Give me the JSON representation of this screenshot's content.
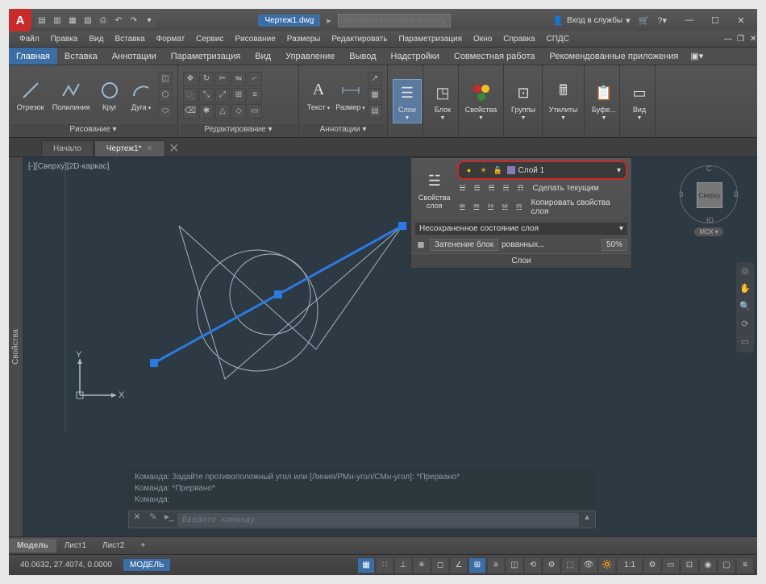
{
  "title": {
    "doc": "Чертеж1.dwg",
    "search_placeholder": "Введите ключевое слово/фразу",
    "signin": "Вход в службы"
  },
  "menu": [
    "Файл",
    "Правка",
    "Вид",
    "Вставка",
    "Формат",
    "Сервис",
    "Рисование",
    "Размеры",
    "Редактировать",
    "Параметризация",
    "Окно",
    "Справка",
    "СПДС"
  ],
  "ribbon_tabs": [
    "Главная",
    "Вставка",
    "Аннотации",
    "Параметризация",
    "Вид",
    "Управление",
    "Вывод",
    "Надстройки",
    "Совместная работа",
    "Рекомендованные приложения"
  ],
  "ribbon": {
    "draw": {
      "title": "Рисование ▾",
      "items": [
        "Отрезок",
        "Полилиния",
        "Круг",
        "Дуга"
      ]
    },
    "modify": {
      "title": "Редактирование ▾"
    },
    "annot": {
      "title": "Аннотации ▾",
      "text": "Текст",
      "dim": "Размер"
    },
    "layers": {
      "title": "Слои",
      "btn": "Слои"
    },
    "block": {
      "title": "Блок",
      "btn": "Блок"
    },
    "props": {
      "title": "Свойства",
      "btn": "Свойства"
    },
    "groups": {
      "title": "Группы",
      "btn": "Группы"
    },
    "utils": {
      "title": "Утилиты",
      "btn": "Утилиты"
    },
    "clip": {
      "title": "Буфе...",
      "btn": "Буфе..."
    },
    "view": {
      "title": "Вид",
      "btn": "Вид"
    }
  },
  "file_tabs": {
    "start": "Начало",
    "doc": "Чертеж1*"
  },
  "viewport_label": "[-][Сверху][2D-каркас]",
  "layers_panel": {
    "props_label": "Свойства\nслоя",
    "current_layer": "Слой 1",
    "make_current": "Сделать текущим",
    "copy_props": "Копировать свойства слоя",
    "state": "Несохраненное состояние слоя",
    "fade_label": "Затенение блок",
    "fade_suffix": "рованных...",
    "fade_pct": "50%",
    "title": "Слои"
  },
  "viewcube": {
    "face": "Сверху",
    "n": "С",
    "s": "Ю",
    "e": "В",
    "w": "З",
    "wcs": "МСК ▾"
  },
  "side_panel": "Свойства",
  "cmd": {
    "hist1": "Команда: Задайте противоположный угол или [Линия/РМн-угол/СМн-угол]: *Прервано*",
    "hist2": "Команда: *Прервано*",
    "hist3": "Команда:",
    "placeholder": "Введите команду"
  },
  "bottom_tabs": [
    "Модель",
    "Лист1",
    "Лист2"
  ],
  "status": {
    "coords": "40.0632, 27.4074, 0.0000",
    "model": "МОДЕЛЬ",
    "scale": "1:1"
  },
  "ucs": {
    "x": "X",
    "y": "Y"
  },
  "colors": {
    "accent": "#3a6ea5",
    "highlight": "#c92a2a",
    "canvas": "#2d3943"
  }
}
